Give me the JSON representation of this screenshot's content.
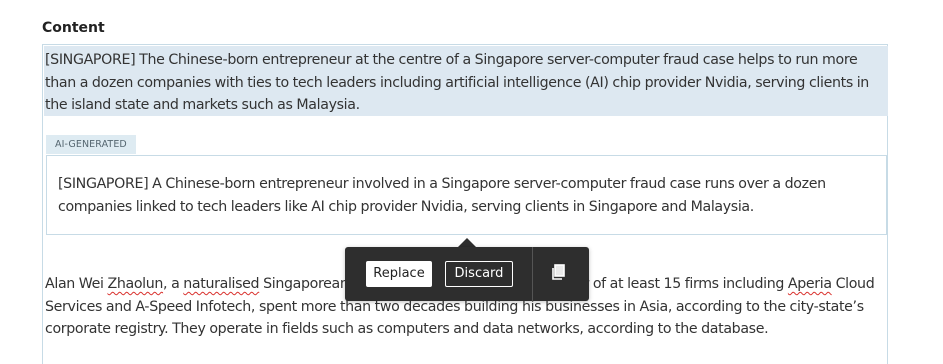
{
  "field": {
    "label": "Content"
  },
  "editor": {
    "paragraph1": "[SINGAPORE] The Chinese-born entrepreneur at the centre of a Singapore server-computer fraud case helps to run more than a dozen companies with ties to tech leaders including artificial intelligence (AI) chip provider Nvidia, serving clients in the island state and markets such as Malaysia.",
    "ai_tag": "AI-GENERATED",
    "ai_suggestion": "[SINGAPORE] A Chinese-born entrepreneur involved in a Singapore server-computer fraud case runs over a dozen companies linked to tech leaders like AI chip provider Nvidia, serving clients in Singapore and Malaysia.",
    "paragraph3": {
      "part1": "Alan Wei ",
      "part2": "Zhaolun",
      "part3": ", a ",
      "part4": "naturalised",
      "part5": " Singaporean, has been a director or shareholder of at least 15 firms including ",
      "part6": "Aperia",
      "part7": " Cloud Services and A-Speed Infotech, spent more than two decades building his businesses in Asia, according to the city-state’s corporate registry. They operate in fields such as computers and data networks, according to the database."
    }
  },
  "toolbar": {
    "replace_label": "Replace",
    "discard_label": "Discard",
    "copy_icon": "copy-icon"
  },
  "colors": {
    "highlight": "#dde8f1",
    "toolbar_bg": "#2e2e2e",
    "border": "#c7dbe6",
    "spellcheck": "#d9302c"
  }
}
